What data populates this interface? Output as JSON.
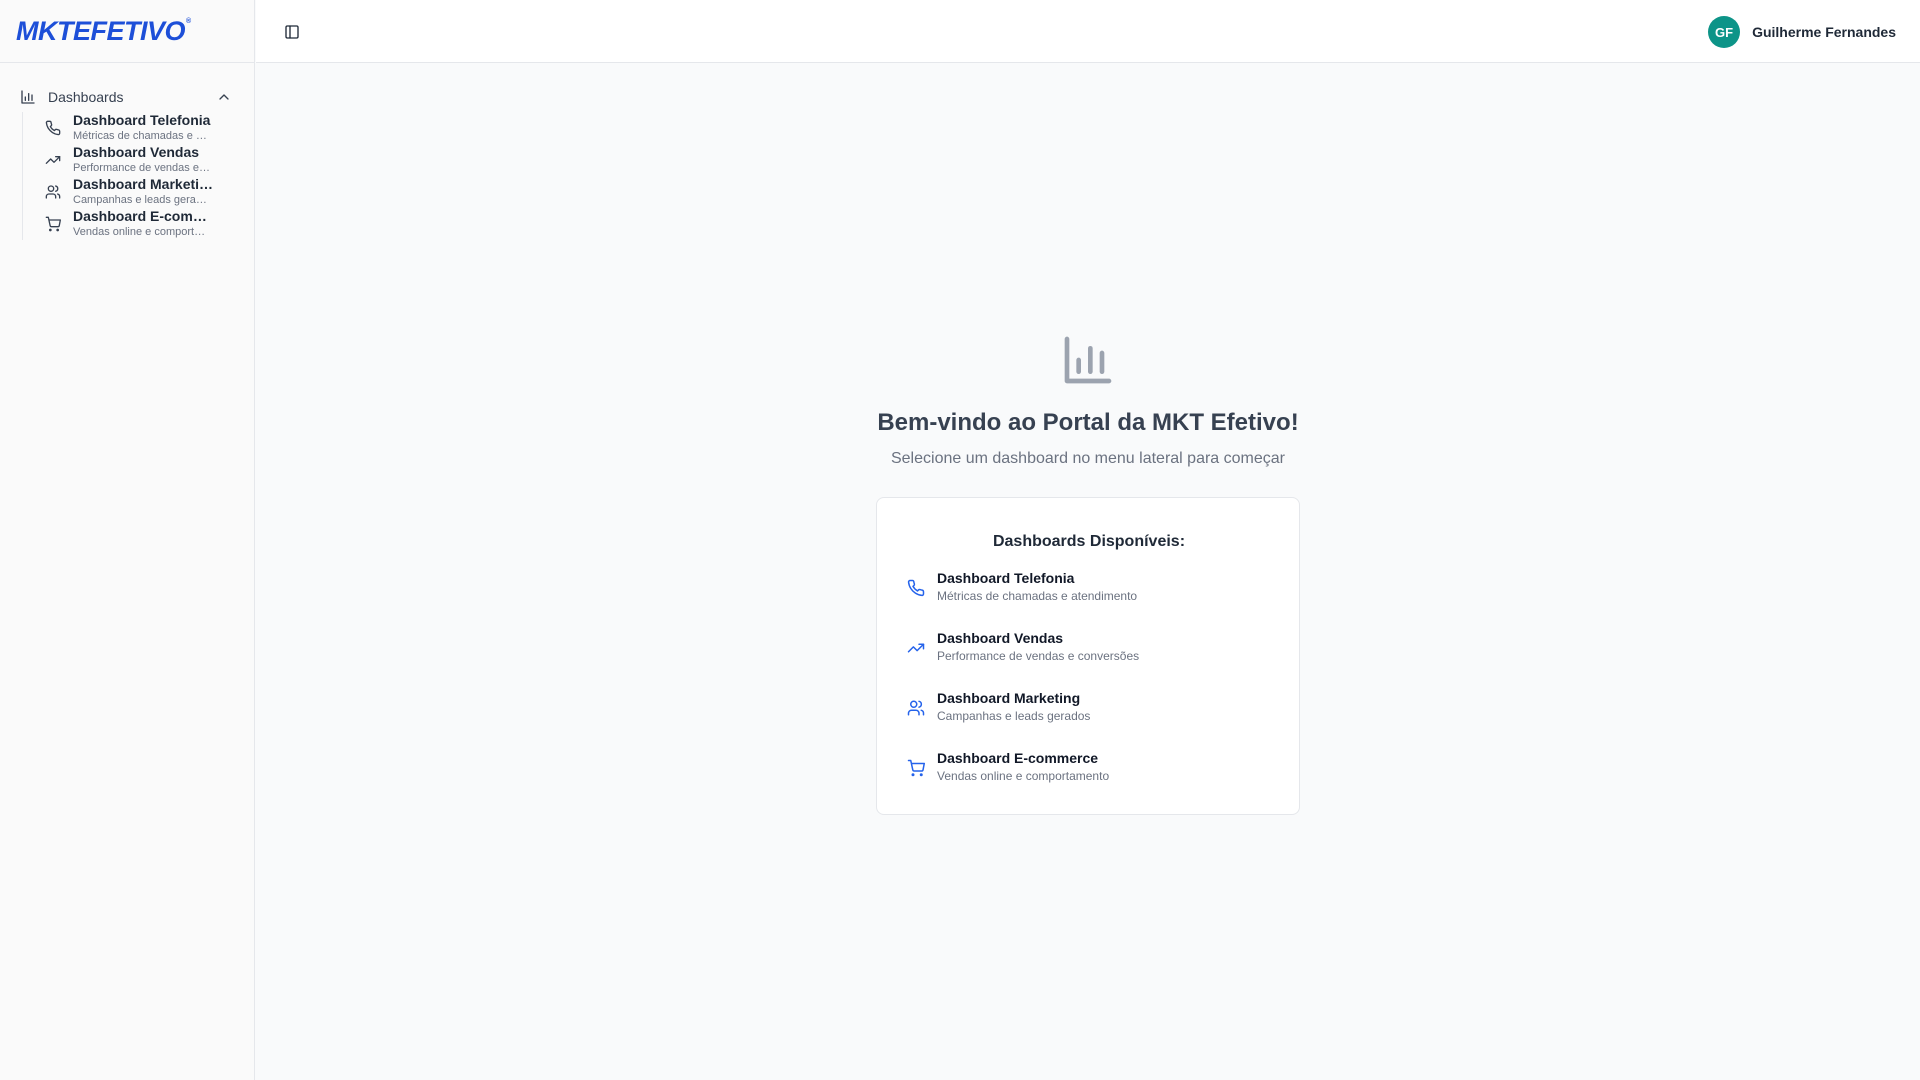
{
  "brand": {
    "logo_text": "MKTEFETIVO",
    "logo_mark": "®",
    "color": "#1d4fd8"
  },
  "sidebar": {
    "group_label": "Dashboards",
    "items": [
      {
        "title": "Dashboard Telefonia",
        "desc": "Métricas de chamadas e atendimento",
        "icon": "phone-icon"
      },
      {
        "title": "Dashboard Vendas",
        "desc": "Performance de vendas e conversões",
        "icon": "trending-up-icon"
      },
      {
        "title": "Dashboard Marketing",
        "desc": "Campanhas e leads gerados",
        "icon": "users-icon"
      },
      {
        "title": "Dashboard E-commerce",
        "desc": "Vendas online e comportamento",
        "icon": "shopping-cart-icon"
      }
    ]
  },
  "topbar": {
    "user_initials": "GF",
    "user_name": "Guilherme Fernandes",
    "avatar_color": "#0d9488"
  },
  "main": {
    "welcome": "Bem-vindo ao Portal da MKT Efetivo!",
    "subtitle": "Selecione um dashboard no menu lateral para começar",
    "card_title": "Dashboards Disponíveis:",
    "items": [
      {
        "title": "Dashboard Telefonia",
        "desc": "Métricas de chamadas e atendimento",
        "icon": "phone-icon"
      },
      {
        "title": "Dashboard Vendas",
        "desc": "Performance de vendas e conversões",
        "icon": "trending-up-icon"
      },
      {
        "title": "Dashboard Marketing",
        "desc": "Campanhas e leads gerados",
        "icon": "users-icon"
      },
      {
        "title": "Dashboard E-commerce",
        "desc": "Vendas online e comportamento",
        "icon": "shopping-cart-icon"
      }
    ],
    "icon_accent": "#2563eb"
  }
}
